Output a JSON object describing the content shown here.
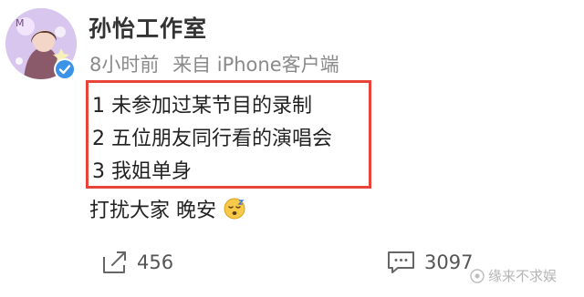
{
  "post": {
    "username": "孙怡工作室",
    "time": "8小时前",
    "source": "来自 iPhone客户端",
    "list": [
      "1 未参加过某节目的录制",
      "2 五位朋友同行看的演唱会",
      "3 我姐单身"
    ],
    "closing": "打扰大家 晚安",
    "emoji_icon": "sleepy-face-icon",
    "avatar_letter": "M"
  },
  "actions": {
    "share_count": "456",
    "comment_count": "3097"
  },
  "watermark": {
    "text": "缘来不求娱"
  },
  "colors": {
    "highlight_border": "#e8443a",
    "verified_badge": "#3a93e8",
    "meta_text": "#8a8a8a"
  }
}
